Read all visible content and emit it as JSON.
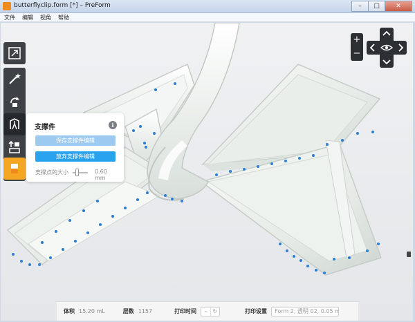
{
  "window": {
    "title": "butterflyclip.form [*] – PreForm",
    "minimize": "–",
    "maximize": "□",
    "close": "✕"
  },
  "menu": [
    "文件",
    "编辑",
    "视角",
    "帮助"
  ],
  "toolbar": {
    "items": [
      {
        "name": "layout-icon"
      },
      {
        "name": "magic-wand-icon"
      },
      {
        "name": "orientation-icon"
      },
      {
        "name": "supports-icon",
        "active": true
      },
      {
        "name": "layout-arrange-icon"
      },
      {
        "name": "print-icon"
      }
    ]
  },
  "panel": {
    "title": "支撑件",
    "info": "i",
    "save_label": "保存支撑件编辑",
    "discard_label": "放弃支撑件编辑",
    "size_label": "支撑点的大小",
    "size_value": "0.60 mm"
  },
  "nav": {
    "zoom_in": "+",
    "zoom_out": "−"
  },
  "status": {
    "volume_label": "体积",
    "volume_value": "15.20 mL",
    "layers_label": "层数",
    "layers_value": "1157",
    "time_label": "打印时间",
    "time_dash": "–",
    "settings_label": "打印设置",
    "settings_value": "Form 2, 透明 02, 0.05 mm"
  },
  "colors": {
    "accent": "#2aa3ef",
    "accent_disabled": "#9ccaf0",
    "toolbar_dark": "#3e4247",
    "print_orange": "#f5a623",
    "support_point": "#2b7fd6"
  }
}
